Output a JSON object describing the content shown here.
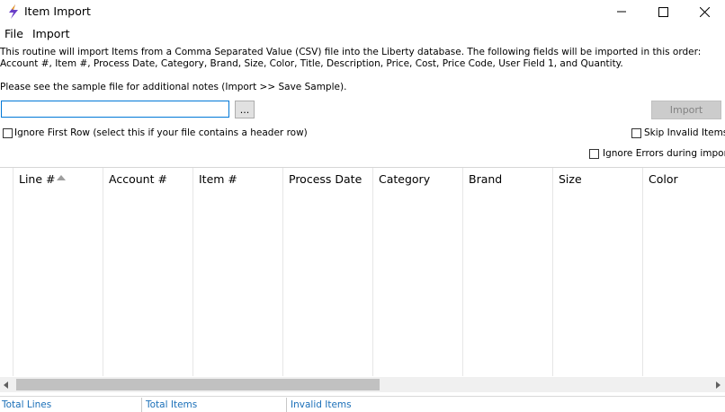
{
  "window": {
    "title": "Item Import"
  },
  "menu": [
    "File",
    "Import"
  ],
  "description": "This routine will import Items from a Comma Separated Value (CSV) file into the Liberty database. The following fields will be imported in this order: Account #, Item #, Process Date, Category, Brand, Size, Color, Title, Description, Price, Cost, Price Code, User Field 1, and Quantity.",
  "note": "Please see the sample file for additional notes (Import >> Save Sample).",
  "file_input": {
    "value": "",
    "placeholder": ""
  },
  "browse_label": "...",
  "import_label": "Import",
  "options": {
    "ignore_first_row": {
      "label": "Ignore First Row (select this if your file contains a header row)",
      "checked": false
    },
    "skip_invalid_items": {
      "label": "Skip Invalid Items",
      "checked": false
    },
    "ignore_errors": {
      "label": "Ignore Errors during import",
      "checked": false
    }
  },
  "grid": {
    "columns": [
      "Line #",
      "Account #",
      "Item #",
      "Process Date",
      "Category",
      "Brand",
      "Size",
      "Color"
    ],
    "sorted_column": "Line #",
    "sort_direction": "ascending",
    "rows": []
  },
  "status": [
    "Total Lines",
    "Total Items",
    "Invalid Items"
  ],
  "colors": {
    "accent": "#0078d7",
    "status_text": "#1a6fb8"
  }
}
